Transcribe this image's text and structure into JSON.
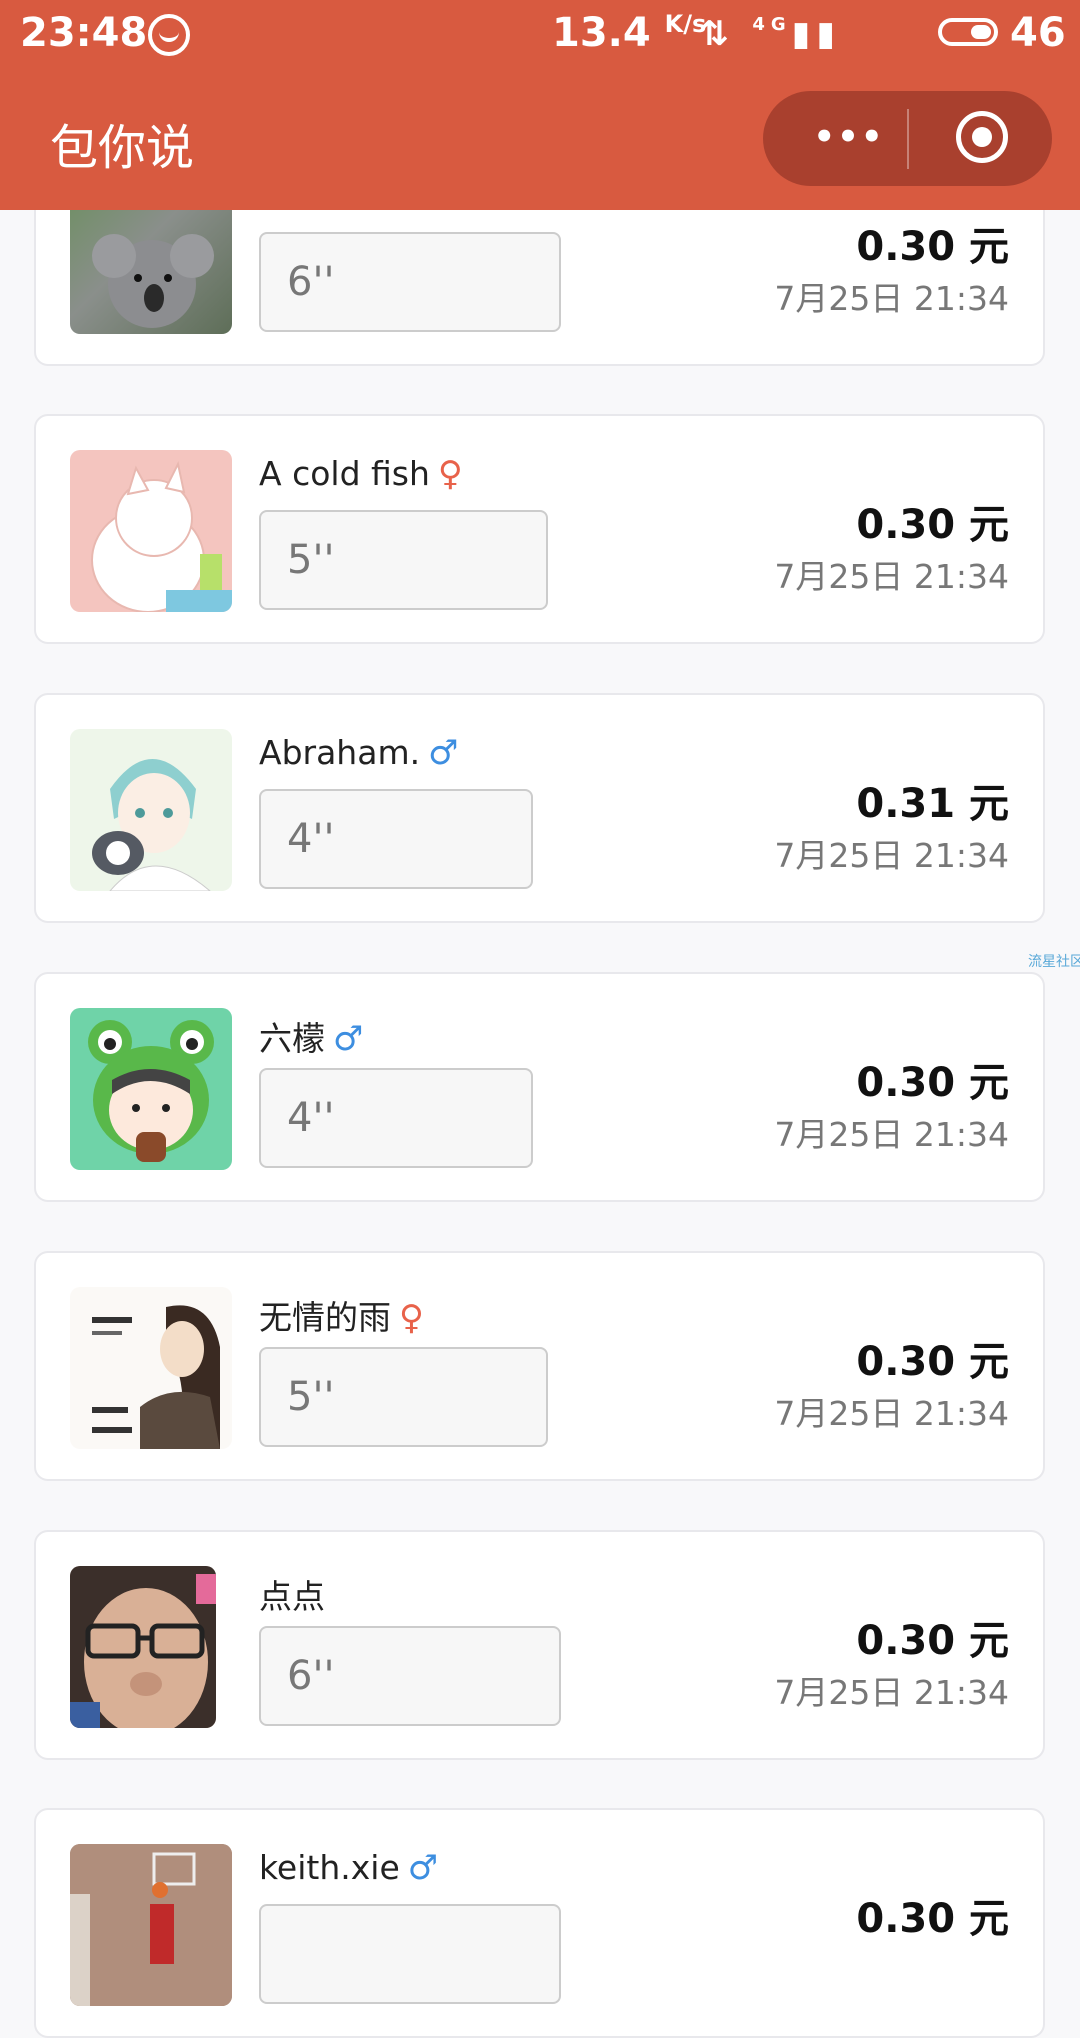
{
  "status_bar": {
    "time": "23:48",
    "speed": "13.4",
    "speed_unit": "K/s",
    "network": "4G",
    "battery": "46"
  },
  "header": {
    "title": "包你说",
    "more_label": "•••"
  },
  "watermark": "流星社区",
  "items": [
    {
      "name": "",
      "gender": "",
      "duration": "6''",
      "amount": "0.30 元",
      "time": "7月25日 21:34"
    },
    {
      "name": "A cold fish",
      "gender": "female",
      "gender_symbol": "♀",
      "duration": "5''",
      "amount": "0.30 元",
      "time": "7月25日 21:34"
    },
    {
      "name": "Abraham.",
      "gender": "male",
      "gender_symbol": "♂",
      "duration": "4''",
      "amount": "0.31 元",
      "time": "7月25日 21:34"
    },
    {
      "name": "六檬",
      "gender": "male",
      "gender_symbol": "♂",
      "duration": "4''",
      "amount": "0.30 元",
      "time": "7月25日 21:34"
    },
    {
      "name": "无情的雨",
      "gender": "female",
      "gender_symbol": "♀",
      "duration": "5''",
      "amount": "0.30 元",
      "time": "7月25日 21:34"
    },
    {
      "name": "点点",
      "gender": "",
      "gender_symbol": "",
      "duration": "6''",
      "amount": "0.30 元",
      "time": "7月25日 21:34"
    },
    {
      "name": "keith.xie",
      "gender": "male",
      "gender_symbol": "♂",
      "duration": "",
      "amount": "0.30 元",
      "time": ""
    }
  ],
  "colors": {
    "header_bg": "#d85a40",
    "female": "#e8624a",
    "male": "#3d8ee0"
  }
}
